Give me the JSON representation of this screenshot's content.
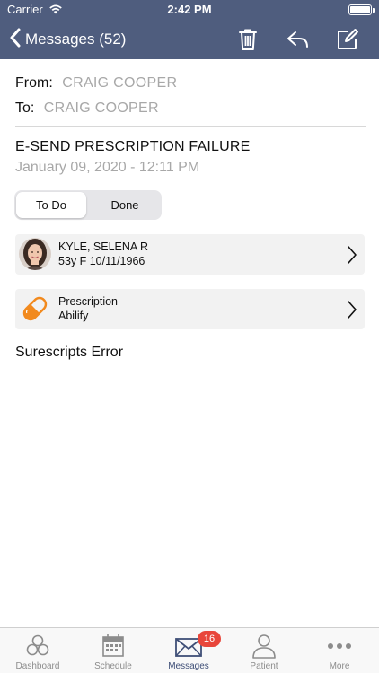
{
  "status_bar": {
    "carrier": "Carrier",
    "time": "2:42 PM"
  },
  "nav": {
    "back_label": "Messages (52)",
    "trash_icon": "trash-icon",
    "reply_icon": "reply-icon",
    "compose_icon": "compose-icon",
    "bar_color": "#4f5d7e"
  },
  "message": {
    "from_label": "From:",
    "from_value": "CRAIG COOPER",
    "to_label": "To:",
    "to_value": "CRAIG COOPER",
    "subject": "E-SEND PRESCRIPTION FAILURE",
    "date": "January 09, 2020 - 12:11 PM",
    "body": "Surescripts Error"
  },
  "segment": {
    "options": [
      "To Do",
      "Done"
    ],
    "selected": "To Do"
  },
  "patient_card": {
    "name": "KYLE, SELENA R",
    "details": "53y F 10/11/1966"
  },
  "rx_card": {
    "title": "Prescription",
    "drug": "Abilify",
    "icon": "pill-icon",
    "icon_color": "#f28a1e"
  },
  "tab_bar": {
    "tabs": [
      {
        "label": "Dashboard",
        "icon": "dashboard-icon"
      },
      {
        "label": "Schedule",
        "icon": "calendar-icon"
      },
      {
        "label": "Messages",
        "icon": "envelope-icon",
        "badge": "16",
        "active": true
      },
      {
        "label": "Patient",
        "icon": "person-icon"
      },
      {
        "label": "More",
        "icon": "more-dots-icon"
      }
    ],
    "badge_color": "#e8463b",
    "active_color": "#3f4f77"
  }
}
